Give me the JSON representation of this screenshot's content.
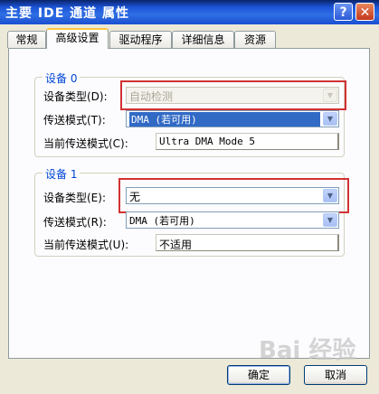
{
  "window": {
    "title": "主要 IDE 通道 属性",
    "help_glyph": "?",
    "close_glyph": "✕"
  },
  "tabs": [
    {
      "label": "常规",
      "active": false
    },
    {
      "label": "高级设置",
      "active": true
    },
    {
      "label": "驱动程序",
      "active": false
    },
    {
      "label": "详细信息",
      "active": false
    },
    {
      "label": "资源",
      "active": false
    }
  ],
  "device0": {
    "title": "设备 0",
    "type_label": "设备类型(D):",
    "type_value": "自动检测",
    "transfer_label": "传送模式(T):",
    "transfer_value": "DMA (若可用)",
    "current_label": "当前传送模式(C):",
    "current_value": "Ultra DMA Mode 5"
  },
  "device1": {
    "title": "设备 1",
    "type_label": "设备类型(E):",
    "type_value": "无",
    "transfer_label": "传送模式(R):",
    "transfer_value": "DMA (若可用)",
    "current_label": "当前传送模式(U):",
    "current_value": "不适用"
  },
  "buttons": {
    "ok": "确定",
    "cancel": "取消"
  },
  "watermark": "Bai 经验",
  "colors": {
    "highlight_box": "#d23232",
    "selection": "#316ac5",
    "group_title": "#0046d5"
  }
}
